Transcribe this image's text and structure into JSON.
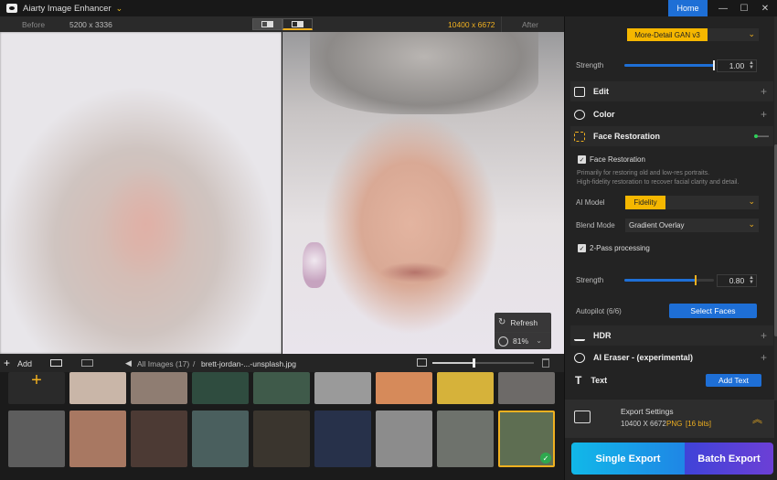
{
  "titlebar": {
    "app_title": "Aiarty Image Enhancer",
    "home_label": "Home",
    "minimize_glyph": "—",
    "maximize_glyph": "☐",
    "close_glyph": "✕"
  },
  "compare": {
    "before_label": "Before",
    "before_size": "5200 x 3336",
    "after_size": "10400 x 6672",
    "after_label": "After"
  },
  "zoom_panel": {
    "refresh_label": "Refresh",
    "zoom_value": "81%"
  },
  "gallery": {
    "add_label": "Add",
    "all_images": "All Images (17)",
    "separator": "/",
    "file_name": "brett-jordan-...-unsplash.jpg",
    "zoom_slider_fraction": 0.42,
    "thumbnails_row1": [
      {
        "color": "#2a2a2a",
        "kind": "add"
      },
      {
        "color": "#c9b6a8"
      },
      {
        "color": "#8f7d72"
      },
      {
        "color": "#2f4c3f"
      },
      {
        "color": "#3f5a4a"
      },
      {
        "color": "#9a9a9a"
      },
      {
        "color": "#d68a5a"
      },
      {
        "color": "#d6b23a"
      },
      {
        "color": "#6d6a68"
      }
    ],
    "thumbnails_row2": [
      {
        "color": "#5d5d5d"
      },
      {
        "color": "#a87862"
      },
      {
        "color": "#4c3a34"
      },
      {
        "color": "#4a5f5e"
      },
      {
        "color": "#3a352e"
      },
      {
        "color": "#27314a"
      },
      {
        "color": "#8c8c8c"
      },
      {
        "color": "#6e726c"
      },
      {
        "color": "#5e6e52",
        "selected": true
      }
    ]
  },
  "panel": {
    "model_value": "More-Detail GAN  v3",
    "strength_label": "Strength",
    "strength_value": "1.00",
    "strength_fraction": 1.0,
    "sections": {
      "edit": "Edit",
      "color": "Color",
      "face_restoration": "Face Restoration",
      "hdr": "HDR",
      "ai_eraser": "AI Eraser - (experimental)",
      "text": "Text"
    },
    "face": {
      "checkbox_label": "Face Restoration",
      "desc_line1": "Primarily for restoring old and low-res portraits.",
      "desc_line2": "High-fidelity restoration to recover facial clarity and detail.",
      "ai_model_label": "AI Model",
      "ai_model_value": "Fidelity",
      "blend_label": "Blend Mode",
      "blend_value": "Gradient Overlay",
      "two_pass_label": "2-Pass processing",
      "strength_label": "Strength",
      "strength_value": "0.80",
      "strength_fraction": 0.8,
      "autopilot_label": "Autopilot (6/6)",
      "select_faces_label": "Select Faces"
    },
    "add_text_label": "Add Text",
    "export_settings": {
      "title": "Export Settings",
      "size": "10400 X 6672",
      "format": "PNG",
      "bits": "[16 bits]"
    },
    "single_export_label": "Single Export",
    "batch_export_label": "Batch Export"
  },
  "colors": {
    "accent_yellow": "#f5b700",
    "accent_blue": "#1e6fd6",
    "status_green": "#2fd05a"
  }
}
